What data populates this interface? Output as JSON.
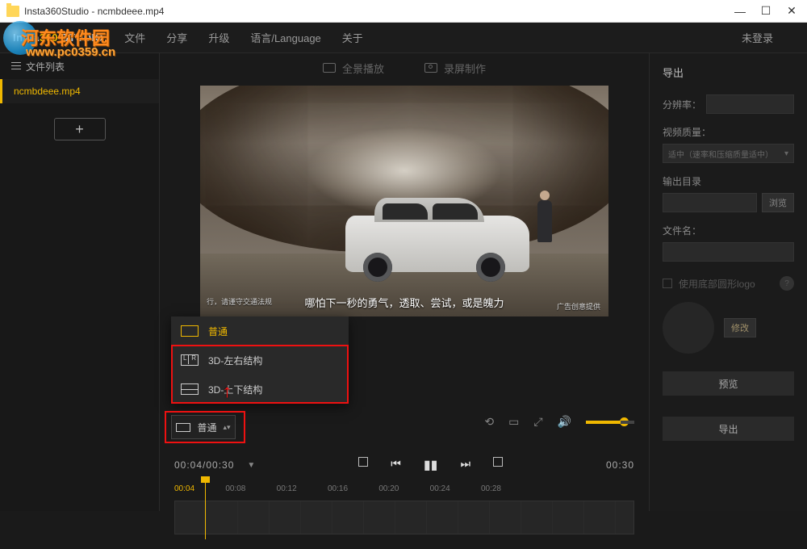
{
  "window": {
    "title": "Insta360Studio  -  ncmbdeee.mp4"
  },
  "watermark": {
    "line1": "河东软件园",
    "line2": "www.pc0359.cn"
  },
  "menu": {
    "logo_prefix": "Insta",
    "logo_num": "360",
    "logo_suffix": " STUDIO",
    "items": [
      "文件",
      "分享",
      "升级",
      "语言/Language",
      "关于"
    ],
    "login": "未登录"
  },
  "sidebar": {
    "header": "文件列表",
    "file": "ncmbdeee.mp4",
    "add": "+"
  },
  "tabs": {
    "panorama": "全景播放",
    "record": "录屏制作"
  },
  "caption": {
    "text": "哪怕下一秒的勇气，透取、尝试，或是魄力",
    "left_note": "行，请谨守交通法规",
    "brand": "广告创意提供"
  },
  "popup": {
    "normal": "普通",
    "three_d_lr": "3D-左右结构",
    "three_d_tb": "3D-上下结构"
  },
  "mode_btn": {
    "label": "普通"
  },
  "playbar": {
    "elapsed": "00:04",
    "total": "00:30",
    "duration_right": "00:30"
  },
  "ticks": [
    "00:04",
    "00:08",
    "00:12",
    "00:16",
    "00:20",
    "00:24",
    "00:28"
  ],
  "panel": {
    "title": "导出",
    "resolution": "分辨率：",
    "quality": "视频质量：",
    "quality_value": "适中（速率和压缩质量适中）",
    "out_dir": "输出目录",
    "browse": "浏览",
    "filename": "文件名：",
    "logo": "使用底部圆形logo",
    "modify": "修改",
    "preview": "预览",
    "export": "导出"
  }
}
